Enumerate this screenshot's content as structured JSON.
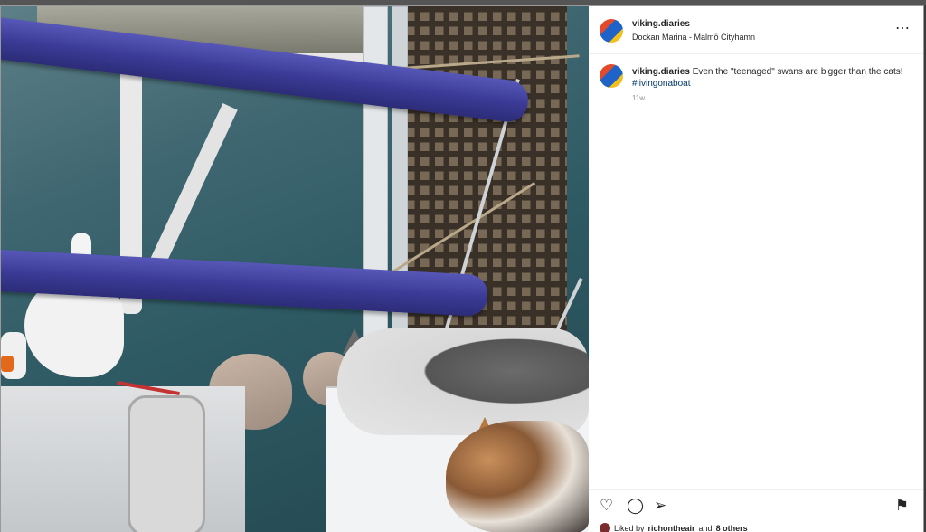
{
  "post": {
    "username": "viking.diaries",
    "location": "Dockan Marina - Malmö Cityhamn",
    "more_icon": "⋯",
    "caption": {
      "username": "viking.diaries",
      "text": "Even the \"teenaged\" swans are bigger than the cats!",
      "hashtag": "#livingonaboat"
    },
    "time": "11w",
    "actions": {
      "heart_icon": "♡",
      "comment_icon": "◯",
      "share_icon": "➢",
      "bookmark_icon": "⚑"
    },
    "likes": {
      "prefix": "Liked by",
      "user": "richontheair",
      "suffix": "and",
      "others": "8 others"
    }
  }
}
